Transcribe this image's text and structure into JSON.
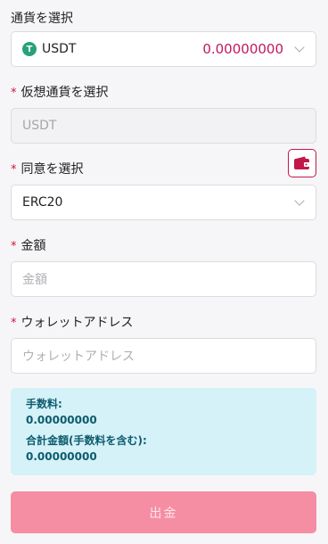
{
  "currency_section": {
    "label": "通貨を選択",
    "selected": "USDT",
    "balance": "0.00000000",
    "icon": "usdt-coin-icon",
    "icon_text": "T",
    "balance_color": "#c2185b"
  },
  "crypto_section": {
    "required_mark": "*",
    "label": "仮想通貨を選択",
    "value": "USDT"
  },
  "network_section": {
    "required_mark": "*",
    "label": "同意を選択",
    "value": "ERC20",
    "wallet_icon": "wallet-icon"
  },
  "amount_section": {
    "required_mark": "*",
    "label": "金額",
    "placeholder": "金額"
  },
  "address_section": {
    "required_mark": "*",
    "label": "ウォレットアドレス",
    "placeholder": "ウォレットアドレス"
  },
  "summary": {
    "fee_label": "手数料:",
    "fee_value": "0.00000000",
    "total_label": "合計金額(手数料を含む):",
    "total_value": "0.00000000"
  },
  "submit": {
    "label": "出金"
  },
  "colors": {
    "accent": "#c21849",
    "submit_bg": "#f68ea3",
    "info_bg": "#d4f2f8",
    "info_text": "#0e5b6e"
  }
}
